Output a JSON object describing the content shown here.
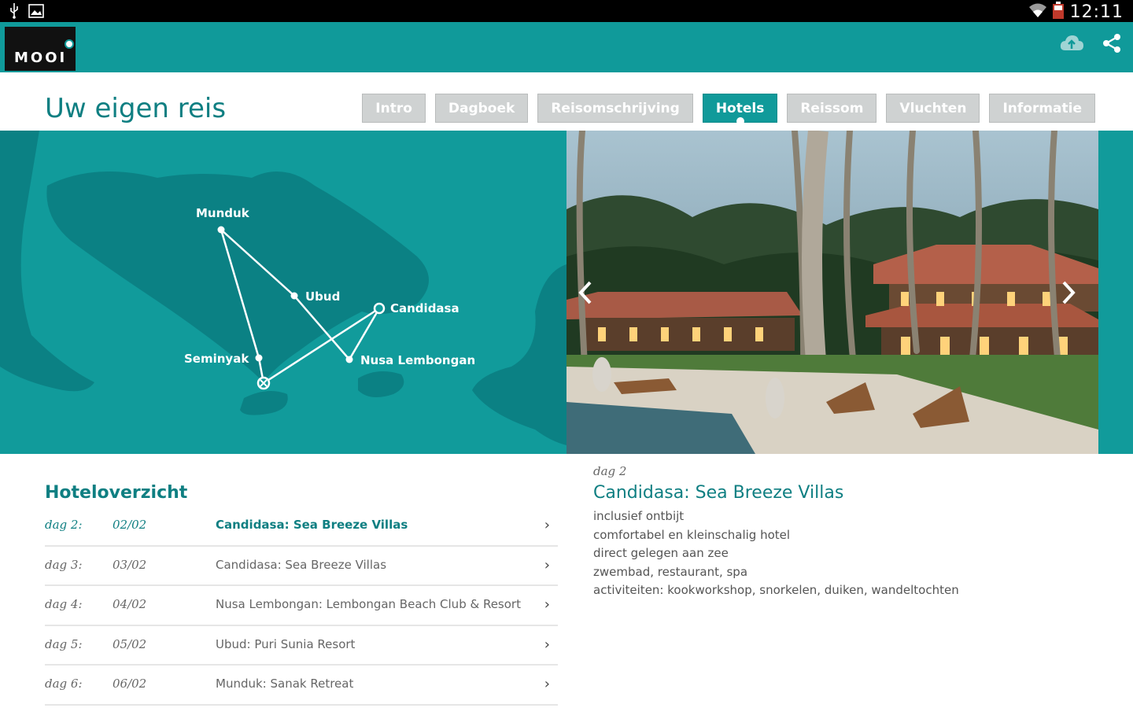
{
  "status_bar": {
    "time": "12:11",
    "left_icons": [
      "usb-icon",
      "image-icon"
    ],
    "right_icons": [
      "wifi-icon",
      "battery-icon"
    ]
  },
  "app_bar": {
    "logo_text": "MOOI",
    "actions": [
      "cloud-upload-icon",
      "share-icon"
    ]
  },
  "header": {
    "title": "Uw eigen reis",
    "tabs": [
      {
        "label": "Intro",
        "active": false
      },
      {
        "label": "Dagboek",
        "active": false
      },
      {
        "label": "Reisomschrijving",
        "active": false
      },
      {
        "label": "Hotels",
        "active": true
      },
      {
        "label": "Reissom",
        "active": false
      },
      {
        "label": "Vluchten",
        "active": false
      },
      {
        "label": "Informatie",
        "active": false
      }
    ]
  },
  "map": {
    "places": {
      "munduk": "Munduk",
      "ubud": "Ubud",
      "candidasa": "Candidasa",
      "seminyak": "Seminyak",
      "nusa_lembongan": "Nusa Lembongan"
    }
  },
  "hotel_overview": {
    "title": "Hoteloverzicht",
    "rows": [
      {
        "day": "dag 2:",
        "date": "02/02",
        "name": "Candidasa: Sea Breeze Villas",
        "active": true
      },
      {
        "day": "dag 3:",
        "date": "03/02",
        "name": "Candidasa: Sea Breeze Villas",
        "active": false
      },
      {
        "day": "dag 4:",
        "date": "04/02",
        "name": "Nusa Lembongan: Lembongan Beach Club & Resort",
        "active": false
      },
      {
        "day": "dag 5:",
        "date": "05/02",
        "name": "Ubud: Puri Sunia Resort",
        "active": false
      },
      {
        "day": "dag 6:",
        "date": "06/02",
        "name": "Munduk: Sanak Retreat",
        "active": false
      }
    ],
    "chevron": "›"
  },
  "detail": {
    "day_label": "dag 2",
    "title": "Candidasa: Sea Breeze Villas",
    "features": [
      "inclusief ontbijt",
      "comfortabel en kleinschalig hotel",
      "direct gelegen aan zee",
      "zwembad, restaurant, spa",
      "activiteiten: kookworkshop, snorkelen, duiken, wandeltochten"
    ]
  },
  "colors": {
    "brand": "#109a9a",
    "brand_dark": "#0f7f82",
    "tab_inactive": "#cfd2d2",
    "map_land": "#0a7f80"
  }
}
